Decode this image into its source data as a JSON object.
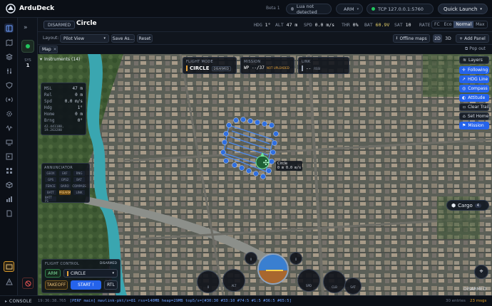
{
  "app": {
    "name": "ArduDeck",
    "beta": "Beta 1",
    "lua": "Lua not detected",
    "arm": "ARM",
    "connection": "TCP 127.0.0.1:5760",
    "quick_launch": "Quick Launch"
  },
  "status": {
    "armed": "DISARMED",
    "mode": "Circle",
    "hdg_label": "HDG",
    "hdg": "1°",
    "alt_label": "ALT",
    "alt": "47 m",
    "spd_label": "SPD",
    "spd": "0.0 m/s",
    "thr_label": "THR",
    "thr": "0%",
    "bat_label": "BAT",
    "bat": "60.9V",
    "sat_label": "SAT",
    "sat": "10",
    "rate_label": "RATE",
    "rate_options": [
      "FC",
      "Eco",
      "Normal",
      "Max"
    ]
  },
  "rail": {
    "sys_label": "SYS",
    "sys_value": "1"
  },
  "toolbar": {
    "layout_label": "Layout:",
    "layout_value": "Pilot View",
    "save_as": "Save As...",
    "reset": "Reset",
    "offline_maps": "Offline maps",
    "view_2d": "2D",
    "view_3d": "3D",
    "add_panel": "+ Add Panel"
  },
  "map_tab": {
    "label": "Map",
    "pop_out": "Pop out"
  },
  "instruments": {
    "header": "Instruments (14)",
    "rows": [
      {
        "k": "MSL",
        "v": "47 m"
      },
      {
        "k": "Rel",
        "v": "0 m"
      },
      {
        "k": "Spd",
        "v": "0.0 m/s"
      },
      {
        "k": "Hdg",
        "v": "1°"
      },
      {
        "k": "Home",
        "v": "0 m"
      },
      {
        "k": "Brng",
        "v": "0°"
      }
    ],
    "coords": "42.441180, 19.263280"
  },
  "flight_mode_card": {
    "title": "FLIGHT MODE",
    "mode": "CIRCLE",
    "state": "DISARMED"
  },
  "mission_card": {
    "title": "MISSION",
    "wp": "WP --/37",
    "note": "NOT UPLOADED"
  },
  "link_card": {
    "title": "LINK",
    "value": "-- ",
    "extra": "RSSI"
  },
  "annunciator": {
    "title": "ANNUNCIATOR",
    "items": [
      "GEOX",
      "EKF",
      "RNG",
      "GPS",
      "GPS2",
      "BAT",
      "FENCE",
      "BARO",
      "COMPASS",
      "BATT",
      "PREARM",
      "LINK",
      "BATT FS"
    ],
    "active": "PREARM"
  },
  "layers": {
    "title": "Layers",
    "buttons": [
      {
        "label": "Following",
        "active": true
      },
      {
        "label": "HDG Line",
        "active": true
      },
      {
        "label": "Compass",
        "active": true
      },
      {
        "label": "Attitude",
        "active": true
      },
      {
        "label": "Clear Trail",
        "active": false
      },
      {
        "label": "Set Home",
        "active": false
      },
      {
        "label": "Mission",
        "active": true
      }
    ]
  },
  "vehicle_label": {
    "mode": "Circle",
    "speed": "0 m 0.0 m/s"
  },
  "cargo": {
    "label": "Cargo",
    "count": "4"
  },
  "flight_control": {
    "title": "FLIGHT CONTROL",
    "state": "DISARMED",
    "arm": "ARM",
    "mode": "CIRCLE",
    "takeoff": "TAKEOFF",
    "start": "START !",
    "rtl": "RTL"
  },
  "gauges": [
    "0",
    "ALT",
    "0",
    "SPD",
    "0",
    "CLB",
    "SAT"
  ],
  "map_status": "DISARMED",
  "console": {
    "label": "CONSOLE",
    "time": "19:36:38.765",
    "message": "[PERF main] mavlink-pkt/s=81 rss=140MB heap=29MB top5/s=[#30:30 #33:10 #74:5 #1:5 #36:5 #65:5]",
    "entries": "30 entries",
    "msgs": "23 msgs"
  },
  "colors": {
    "accent": "#2563eb",
    "armed_green": "#22c55e",
    "mission": "#3b82f6"
  }
}
